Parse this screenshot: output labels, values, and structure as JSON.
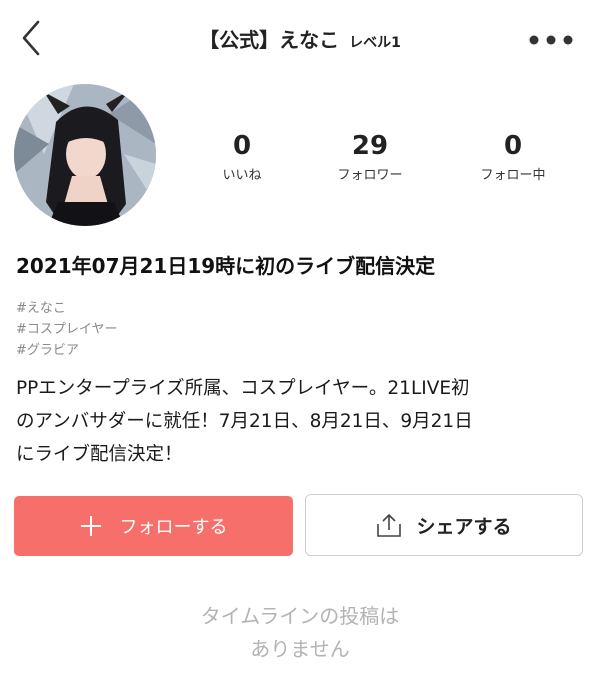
{
  "header": {
    "title": "【公式】えなこ",
    "level": "レベル1"
  },
  "stats": [
    {
      "value": "0",
      "label": "いいね"
    },
    {
      "value": "29",
      "label": "フォロワー"
    },
    {
      "value": "0",
      "label": "フォロー中"
    }
  ],
  "profile": {
    "headline": "2021年07月21日19時に初のライブ配信決定",
    "tags": [
      "#えなこ",
      "#コスプレイヤー",
      "#グラビア"
    ],
    "bio_lines": [
      "PPエンタープライズ所属、コスプレイヤー。21LIVE初",
      "のアンバサダーに就任！7月21日、8月21日、9月21日",
      "にライブ配信決定！"
    ]
  },
  "actions": {
    "follow_label": "フォローする",
    "share_label": "シェアする"
  },
  "timeline": {
    "empty_lines": [
      "タイムラインの投稿は",
      "ありません"
    ]
  },
  "colors": {
    "accent": "#f76f6a",
    "muted_text": "#8a8a8a",
    "empty_text": "#b3b3b3"
  },
  "icons": {
    "back": "chevron-left-icon",
    "more": "more-dots-icon",
    "follow": "plus-icon",
    "share": "share-upload-icon"
  }
}
